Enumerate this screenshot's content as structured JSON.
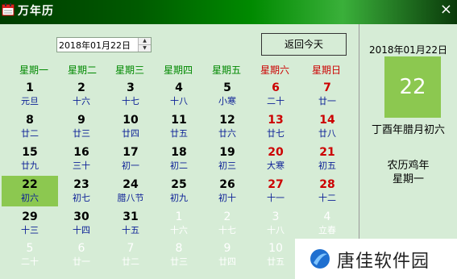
{
  "window": {
    "title": "万年历",
    "close_glyph": "×",
    "app_icon": "calendar-icon"
  },
  "date_picker": {
    "value": "2018年01月22日"
  },
  "today_button": {
    "label": "返回今天"
  },
  "weekdays": [
    {
      "label": "星期一",
      "color": "#008800"
    },
    {
      "label": "星期二",
      "color": "#008800"
    },
    {
      "label": "星期三",
      "color": "#008800"
    },
    {
      "label": "星期四",
      "color": "#008800"
    },
    {
      "label": "星期五",
      "color": "#008800"
    },
    {
      "label": "星期六",
      "color": "#cc0000"
    },
    {
      "label": "星期日",
      "color": "#cc0000"
    }
  ],
  "colors": {
    "day_normal": "#000000",
    "weekend": "#cc0000",
    "lunar": "#0a1e96",
    "other_month": "#ffffff",
    "selected_bg": "#8cc850"
  },
  "calendar": [
    [
      {
        "day": "1",
        "lunar": "元旦"
      },
      {
        "day": "2",
        "lunar": "十六"
      },
      {
        "day": "3",
        "lunar": "十七"
      },
      {
        "day": "4",
        "lunar": "十八"
      },
      {
        "day": "5",
        "lunar": "小寒"
      },
      {
        "day": "6",
        "lunar": "二十"
      },
      {
        "day": "7",
        "lunar": "廿一"
      }
    ],
    [
      {
        "day": "8",
        "lunar": "廿二"
      },
      {
        "day": "9",
        "lunar": "廿三"
      },
      {
        "day": "10",
        "lunar": "廿四"
      },
      {
        "day": "11",
        "lunar": "廿五"
      },
      {
        "day": "12",
        "lunar": "廿六"
      },
      {
        "day": "13",
        "lunar": "廿七"
      },
      {
        "day": "14",
        "lunar": "廿八"
      }
    ],
    [
      {
        "day": "15",
        "lunar": "廿九"
      },
      {
        "day": "16",
        "lunar": "三十"
      },
      {
        "day": "17",
        "lunar": "初一"
      },
      {
        "day": "18",
        "lunar": "初二"
      },
      {
        "day": "19",
        "lunar": "初三"
      },
      {
        "day": "20",
        "lunar": "大寒"
      },
      {
        "day": "21",
        "lunar": "初五"
      }
    ],
    [
      {
        "day": "22",
        "lunar": "初六",
        "selected": true
      },
      {
        "day": "23",
        "lunar": "初七"
      },
      {
        "day": "24",
        "lunar": "腊八节"
      },
      {
        "day": "25",
        "lunar": "初九"
      },
      {
        "day": "26",
        "lunar": "初十"
      },
      {
        "day": "27",
        "lunar": "十一"
      },
      {
        "day": "28",
        "lunar": "十二"
      }
    ],
    [
      {
        "day": "29",
        "lunar": "十三"
      },
      {
        "day": "30",
        "lunar": "十四"
      },
      {
        "day": "31",
        "lunar": "十五"
      },
      {
        "day": "1",
        "lunar": "十六",
        "other": true
      },
      {
        "day": "2",
        "lunar": "十七",
        "other": true
      },
      {
        "day": "3",
        "lunar": "十八",
        "other": true
      },
      {
        "day": "4",
        "lunar": "立春",
        "other": true
      }
    ],
    [
      {
        "day": "5",
        "lunar": "二十",
        "other": true
      },
      {
        "day": "6",
        "lunar": "廿一",
        "other": true
      },
      {
        "day": "7",
        "lunar": "廿二",
        "other": true
      },
      {
        "day": "8",
        "lunar": "廿三",
        "other": true
      },
      {
        "day": "9",
        "lunar": "廿四",
        "other": true
      },
      {
        "day": "10",
        "lunar": "廿五",
        "other": true
      },
      {
        "day": "11",
        "lunar": "廿六",
        "other": true
      }
    ]
  ],
  "side_panel": {
    "date": "2018年01月22日",
    "big_day": "22",
    "lunar_date": "丁酉年腊月初六",
    "ganzhi": "农历鸡年",
    "weekday": "星期一"
  },
  "watermark": {
    "text": "唐佳软件园"
  }
}
